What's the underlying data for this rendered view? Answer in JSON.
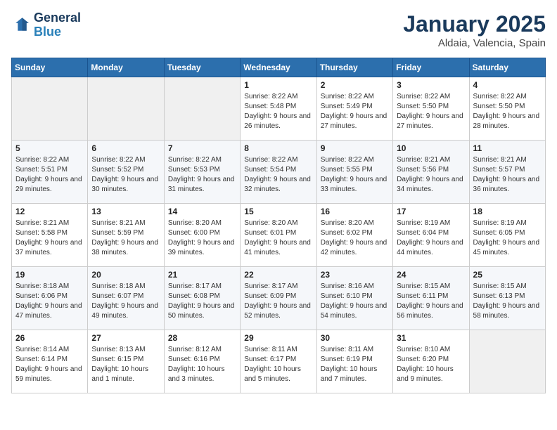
{
  "header": {
    "logo_line1": "General",
    "logo_line2": "Blue",
    "month": "January 2025",
    "location": "Aldaia, Valencia, Spain"
  },
  "weekdays": [
    "Sunday",
    "Monday",
    "Tuesday",
    "Wednesday",
    "Thursday",
    "Friday",
    "Saturday"
  ],
  "weeks": [
    [
      {
        "day": "",
        "info": ""
      },
      {
        "day": "",
        "info": ""
      },
      {
        "day": "",
        "info": ""
      },
      {
        "day": "1",
        "info": "Sunrise: 8:22 AM\nSunset: 5:48 PM\nDaylight: 9 hours and 26 minutes."
      },
      {
        "day": "2",
        "info": "Sunrise: 8:22 AM\nSunset: 5:49 PM\nDaylight: 9 hours and 27 minutes."
      },
      {
        "day": "3",
        "info": "Sunrise: 8:22 AM\nSunset: 5:50 PM\nDaylight: 9 hours and 27 minutes."
      },
      {
        "day": "4",
        "info": "Sunrise: 8:22 AM\nSunset: 5:50 PM\nDaylight: 9 hours and 28 minutes."
      }
    ],
    [
      {
        "day": "5",
        "info": "Sunrise: 8:22 AM\nSunset: 5:51 PM\nDaylight: 9 hours and 29 minutes."
      },
      {
        "day": "6",
        "info": "Sunrise: 8:22 AM\nSunset: 5:52 PM\nDaylight: 9 hours and 30 minutes."
      },
      {
        "day": "7",
        "info": "Sunrise: 8:22 AM\nSunset: 5:53 PM\nDaylight: 9 hours and 31 minutes."
      },
      {
        "day": "8",
        "info": "Sunrise: 8:22 AM\nSunset: 5:54 PM\nDaylight: 9 hours and 32 minutes."
      },
      {
        "day": "9",
        "info": "Sunrise: 8:22 AM\nSunset: 5:55 PM\nDaylight: 9 hours and 33 minutes."
      },
      {
        "day": "10",
        "info": "Sunrise: 8:21 AM\nSunset: 5:56 PM\nDaylight: 9 hours and 34 minutes."
      },
      {
        "day": "11",
        "info": "Sunrise: 8:21 AM\nSunset: 5:57 PM\nDaylight: 9 hours and 36 minutes."
      }
    ],
    [
      {
        "day": "12",
        "info": "Sunrise: 8:21 AM\nSunset: 5:58 PM\nDaylight: 9 hours and 37 minutes."
      },
      {
        "day": "13",
        "info": "Sunrise: 8:21 AM\nSunset: 5:59 PM\nDaylight: 9 hours and 38 minutes."
      },
      {
        "day": "14",
        "info": "Sunrise: 8:20 AM\nSunset: 6:00 PM\nDaylight: 9 hours and 39 minutes."
      },
      {
        "day": "15",
        "info": "Sunrise: 8:20 AM\nSunset: 6:01 PM\nDaylight: 9 hours and 41 minutes."
      },
      {
        "day": "16",
        "info": "Sunrise: 8:20 AM\nSunset: 6:02 PM\nDaylight: 9 hours and 42 minutes."
      },
      {
        "day": "17",
        "info": "Sunrise: 8:19 AM\nSunset: 6:04 PM\nDaylight: 9 hours and 44 minutes."
      },
      {
        "day": "18",
        "info": "Sunrise: 8:19 AM\nSunset: 6:05 PM\nDaylight: 9 hours and 45 minutes."
      }
    ],
    [
      {
        "day": "19",
        "info": "Sunrise: 8:18 AM\nSunset: 6:06 PM\nDaylight: 9 hours and 47 minutes."
      },
      {
        "day": "20",
        "info": "Sunrise: 8:18 AM\nSunset: 6:07 PM\nDaylight: 9 hours and 49 minutes."
      },
      {
        "day": "21",
        "info": "Sunrise: 8:17 AM\nSunset: 6:08 PM\nDaylight: 9 hours and 50 minutes."
      },
      {
        "day": "22",
        "info": "Sunrise: 8:17 AM\nSunset: 6:09 PM\nDaylight: 9 hours and 52 minutes."
      },
      {
        "day": "23",
        "info": "Sunrise: 8:16 AM\nSunset: 6:10 PM\nDaylight: 9 hours and 54 minutes."
      },
      {
        "day": "24",
        "info": "Sunrise: 8:15 AM\nSunset: 6:11 PM\nDaylight: 9 hours and 56 minutes."
      },
      {
        "day": "25",
        "info": "Sunrise: 8:15 AM\nSunset: 6:13 PM\nDaylight: 9 hours and 58 minutes."
      }
    ],
    [
      {
        "day": "26",
        "info": "Sunrise: 8:14 AM\nSunset: 6:14 PM\nDaylight: 9 hours and 59 minutes."
      },
      {
        "day": "27",
        "info": "Sunrise: 8:13 AM\nSunset: 6:15 PM\nDaylight: 10 hours and 1 minute."
      },
      {
        "day": "28",
        "info": "Sunrise: 8:12 AM\nSunset: 6:16 PM\nDaylight: 10 hours and 3 minutes."
      },
      {
        "day": "29",
        "info": "Sunrise: 8:11 AM\nSunset: 6:17 PM\nDaylight: 10 hours and 5 minutes."
      },
      {
        "day": "30",
        "info": "Sunrise: 8:11 AM\nSunset: 6:19 PM\nDaylight: 10 hours and 7 minutes."
      },
      {
        "day": "31",
        "info": "Sunrise: 8:10 AM\nSunset: 6:20 PM\nDaylight: 10 hours and 9 minutes."
      },
      {
        "day": "",
        "info": ""
      }
    ]
  ]
}
